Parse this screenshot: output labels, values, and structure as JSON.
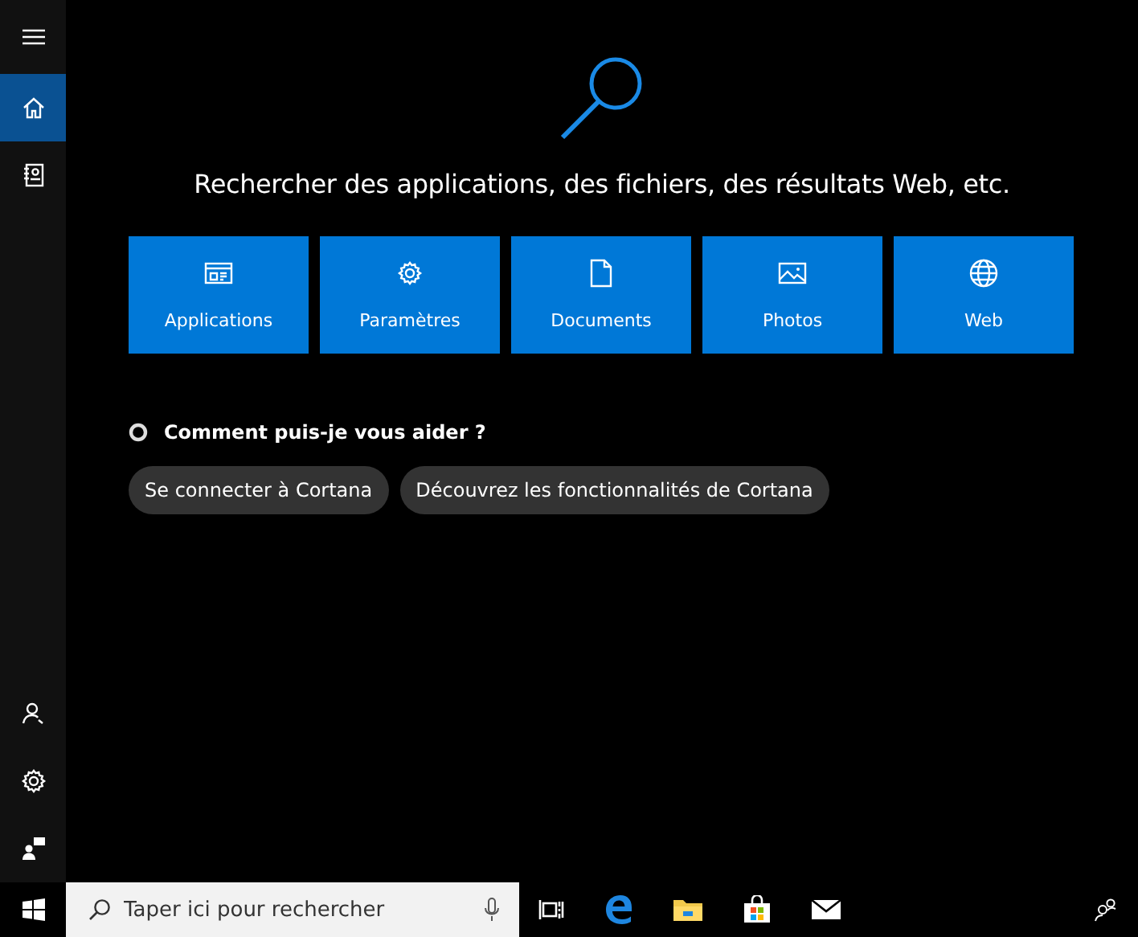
{
  "sidebar": {
    "items": [
      {
        "kind": "home",
        "selected": true
      },
      {
        "kind": "notebook",
        "selected": false
      }
    ]
  },
  "heading": "Rechercher des applications, des fichiers, des résultats Web, etc.",
  "categories": [
    {
      "kind": "apps",
      "label": "Applications"
    },
    {
      "kind": "settings",
      "label": "Paramètres"
    },
    {
      "kind": "documents",
      "label": "Documents"
    },
    {
      "kind": "photos",
      "label": "Photos"
    },
    {
      "kind": "web",
      "label": "Web"
    }
  ],
  "prompt": "Comment puis-je vous aider ?",
  "suggestions": [
    "Se connecter à Cortana",
    "Découvrez les fonctionnalités de Cortana"
  ],
  "taskbar": {
    "search": {
      "placeholder": "Taper ici pour rechercher"
    }
  }
}
